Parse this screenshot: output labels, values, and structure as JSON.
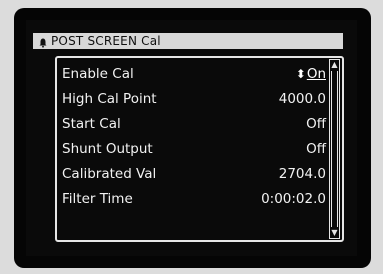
{
  "screen": {
    "title": "POST SCREEN Cal",
    "rows": [
      {
        "label": "Enable Cal",
        "value": "On",
        "selected": true
      },
      {
        "label": "High Cal Point",
        "value": "4000.0"
      },
      {
        "label": "Start Cal",
        "value": "Off"
      },
      {
        "label": "Shunt Output",
        "value": "Off"
      },
      {
        "label": "Calibrated Val",
        "value": "2704.0"
      },
      {
        "label": "Filter Time",
        "value": "0:00:02.0"
      }
    ]
  },
  "icons": {
    "title_icon": "bell-icon",
    "selector_icon": "up-down-arrow-icon",
    "scroll_up": "scroll-up-arrow-icon",
    "scroll_down": "scroll-down-arrow-icon"
  }
}
